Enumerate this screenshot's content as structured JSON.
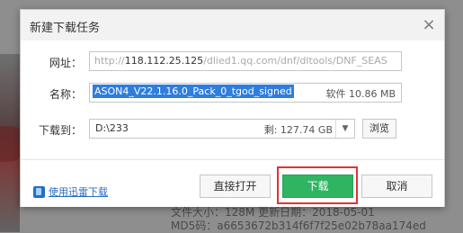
{
  "background": {
    "info_line1": "文件大小：128M 更新日期：2018-05-01",
    "info_line2": "MD5码：a6653672b314f6f7f25e02b78aa174ed"
  },
  "dialog": {
    "title": "新建下载任务",
    "close_icon": "close-icon",
    "url": {
      "label": "网址：",
      "prefix": "http://",
      "host": "118.112.25.125",
      "path": "/dlied1.qq.com/dnf/dltools/DNF_SEAS"
    },
    "name": {
      "label": "名称：",
      "value": "ASON4_V22.1.16.0_Pack_0_tgod_signed",
      "size": "软件 10.86 MB"
    },
    "download_to": {
      "label": "下载到：",
      "path": "D:\\233",
      "free": "剩: 127.74 GB",
      "dropdown_icon": "chevron-down-icon",
      "browse_label": "浏览"
    },
    "footer": {
      "xunlei_link": "使用迅雷下载",
      "open_label": "直接打开",
      "download_label": "下载",
      "cancel_label": "取消"
    }
  }
}
